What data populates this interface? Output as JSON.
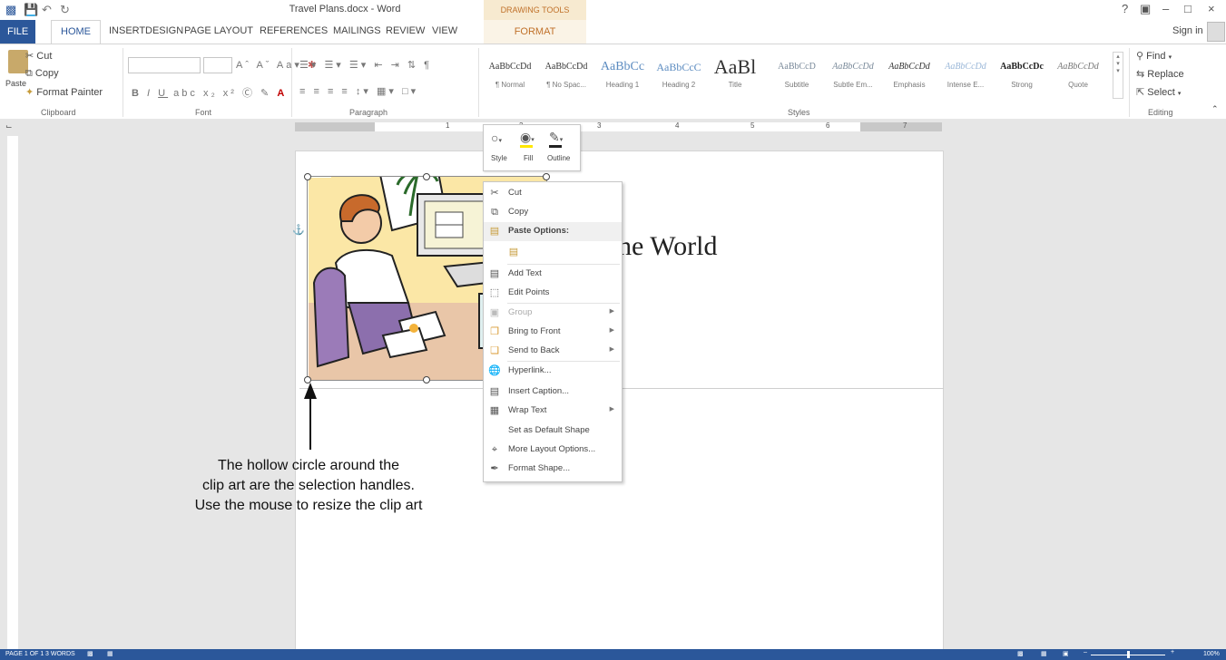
{
  "window": {
    "title": "Travel Plans.docx - Word",
    "context_header": "DRAWING TOOLS",
    "controls": [
      "?",
      "▣",
      "–",
      "□",
      "×"
    ],
    "sign_in": "Sign in"
  },
  "tabs": [
    "FILE",
    "HOME",
    "INSERT",
    "DESIGN",
    "PAGE LAYOUT",
    "REFERENCES",
    "MAILINGS",
    "REVIEW",
    "VIEW",
    "FORMAT"
  ],
  "ribbon": {
    "clipboard": {
      "paste": "Paste",
      "cut": "Cut",
      "copy": "Copy",
      "format_painter": "Format Painter",
      "label": "Clipboard"
    },
    "font": {
      "label": "Font"
    },
    "paragraph": {
      "label": "Paragraph"
    },
    "styles": {
      "label": "Styles",
      "items": [
        {
          "sample": "AaBbCcDd",
          "name": "¶ Normal"
        },
        {
          "sample": "AaBbCcDd",
          "name": "¶ No Spac..."
        },
        {
          "sample": "AaBbCc",
          "name": "Heading 1"
        },
        {
          "sample": "AaBbCcC",
          "name": "Heading 2"
        },
        {
          "sample": "AaBl",
          "name": "Title"
        },
        {
          "sample": "AaBbCcD",
          "name": "Subtitle"
        },
        {
          "sample": "AaBbCcDd",
          "name": "Subtle Em..."
        },
        {
          "sample": "AaBbCcDd",
          "name": "Emphasis"
        },
        {
          "sample": "AaBbCcDd",
          "name": "Intense E..."
        },
        {
          "sample": "AaBbCcDc",
          "name": "Strong"
        },
        {
          "sample": "AaBbCcDd",
          "name": "Quote"
        }
      ]
    },
    "editing": {
      "find": "Find",
      "replace": "Replace",
      "select": "Select",
      "label": "Editing"
    }
  },
  "ruler_numbers": [
    "1",
    "2",
    "3",
    "4",
    "5",
    "6",
    "7"
  ],
  "document": {
    "visible_text": "he World"
  },
  "mini_toolbar": {
    "style": "Style",
    "fill": "Fill",
    "outline": "Outline"
  },
  "context_menu": {
    "cut": "Cut",
    "copy": "Copy",
    "paste_options": "Paste Options:",
    "add_text": "Add Text",
    "edit_points": "Edit Points",
    "group": "Group",
    "bring_to_front": "Bring to Front",
    "send_to_back": "Send to Back",
    "hyperlink": "Hyperlink...",
    "insert_caption": "Insert Caption...",
    "wrap_text": "Wrap Text",
    "set_default": "Set as Default Shape",
    "more_layout": "More Layout Options...",
    "format_shape": "Format Shape..."
  },
  "annotation": {
    "line1": "The hollow circle around the",
    "line2": "clip art are the selection handles.",
    "line3": "Use the mouse to resize the clip art"
  },
  "status": {
    "page": "PAGE 1 OF 1",
    "words": "3 WORDS",
    "zoom": "100%"
  },
  "colors": {
    "accent": "#2b579a",
    "context": "#c0712a"
  }
}
